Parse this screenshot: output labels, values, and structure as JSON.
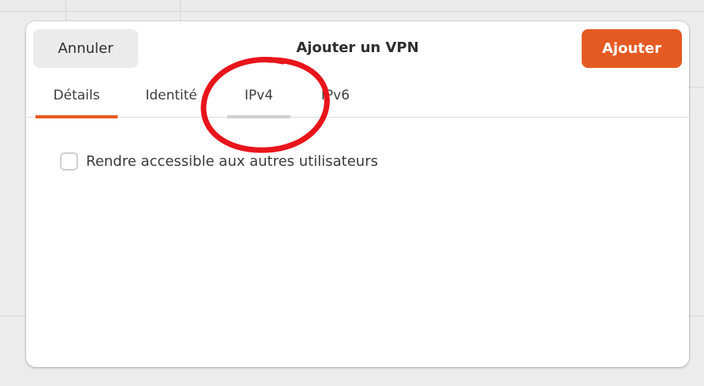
{
  "dialog": {
    "title": "Ajouter un VPN",
    "cancel_label": "Annuler",
    "add_label": "Ajouter"
  },
  "tabs": [
    {
      "label": "Détails",
      "state": "active"
    },
    {
      "label": "Identité",
      "state": "normal"
    },
    {
      "label": "IPv4",
      "state": "hover"
    },
    {
      "label": "IPv6",
      "state": "normal"
    }
  ],
  "content": {
    "share_checkbox_label": "Rendre accessible aux autres utilisateurs",
    "share_checkbox_checked": false
  },
  "colors": {
    "accent": "#e55a22",
    "annotation": "#e8141b"
  }
}
